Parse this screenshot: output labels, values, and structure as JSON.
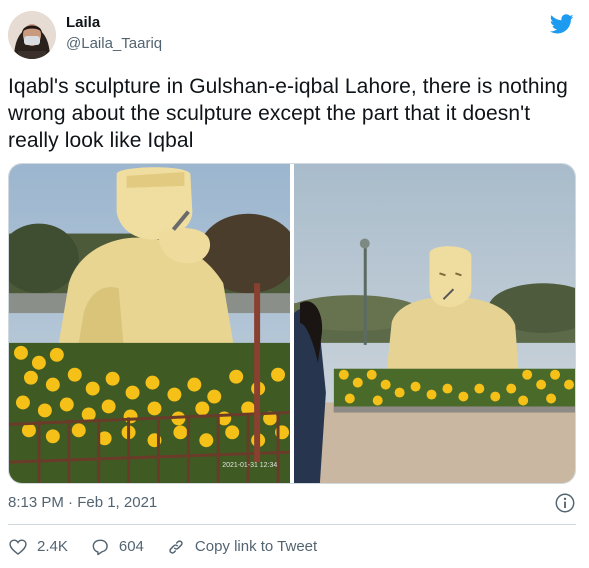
{
  "author": {
    "display_name": "Laila",
    "handle": "@Laila_Taariq"
  },
  "tweet": {
    "text": "Iqabl's sculpture in Gulshan-e-iqbal Lahore, there is nothing wrong about the sculpture except the part that it doesn't really look like Iqbal",
    "timestamp": "8:13 PM · Feb 1, 2021"
  },
  "actions": {
    "likes": "2.4K",
    "replies": "604",
    "copy_link_label": "Copy link to Tweet"
  },
  "photos": [
    {
      "watermark": "2021-01-31 12:34"
    },
    {}
  ],
  "icons": {
    "brand": "twitter-bird-icon",
    "info": "info-icon",
    "like": "heart-icon",
    "reply": "reply-bubble-icon",
    "copy_link": "link-icon"
  },
  "colors": {
    "twitter_blue": "#1d9bf0",
    "secondary_text": "#536471",
    "border": "#cfd9de"
  }
}
